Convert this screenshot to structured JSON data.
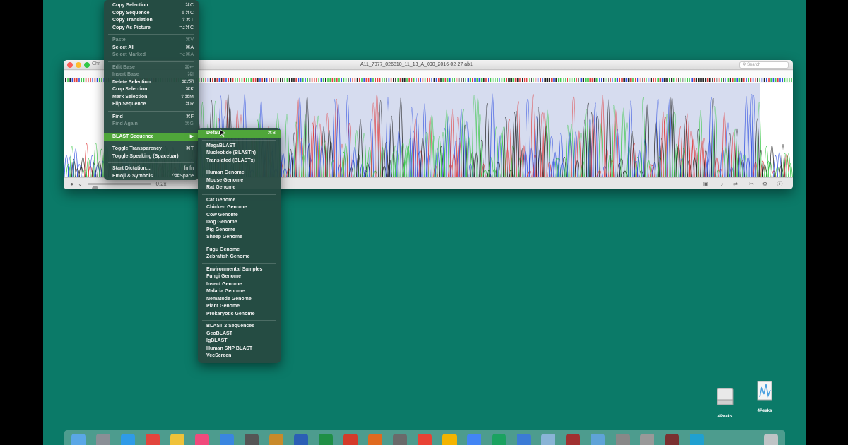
{
  "window": {
    "app_stub": "Chr",
    "title": "A11_7077_026810_11_13_A_090_2016-02-27.ab1",
    "search_placeholder": "Search",
    "zoom_label": "0.2x"
  },
  "ruler": {
    "sequence_hint": "ACGT"
  },
  "main_menu": {
    "items": [
      {
        "label": "Copy Selection",
        "shortcut": "⌘C",
        "disabled": false
      },
      {
        "label": "Copy Sequence",
        "shortcut": "⇧⌘C",
        "disabled": false
      },
      {
        "label": "Copy Translation",
        "shortcut": "⇧⌘T",
        "disabled": false
      },
      {
        "label": "Copy As Picture",
        "shortcut": "⌥⌘C",
        "disabled": false
      },
      {
        "label": "Paste",
        "shortcut": "⌘V",
        "disabled": true
      },
      {
        "label": "Select All",
        "shortcut": "⌘A",
        "disabled": false
      },
      {
        "label": "Select Marked",
        "shortcut": "⌥⌘A",
        "disabled": true
      },
      {
        "label": "Edit Base",
        "shortcut": "⌘↩",
        "disabled": true
      },
      {
        "label": "Insert Base",
        "shortcut": "⌘I",
        "disabled": true
      },
      {
        "label": "Delete Selection",
        "shortcut": "⌘⌫",
        "disabled": false
      },
      {
        "label": "Crop Selection",
        "shortcut": "⌘K",
        "disabled": false
      },
      {
        "label": "Mark Selection",
        "shortcut": "⇧⌘M",
        "disabled": false
      },
      {
        "label": "Flip Sequence",
        "shortcut": "⌘R",
        "disabled": false
      },
      {
        "label": "Find",
        "shortcut": "⌘F",
        "disabled": false
      },
      {
        "label": "Find Again",
        "shortcut": "⌘G",
        "disabled": true
      },
      {
        "label": "BLAST Sequence",
        "shortcut": "▶",
        "disabled": false
      },
      {
        "label": "Toggle Transparency",
        "shortcut": "⌘T",
        "disabled": false
      },
      {
        "label": "Toggle Speaking (Spacebar)",
        "shortcut": "",
        "disabled": false
      },
      {
        "label": "Start Dictation...",
        "shortcut": "fn fn",
        "disabled": false
      },
      {
        "label": "Emoji & Symbols",
        "shortcut": "^⌘Space",
        "disabled": false
      }
    ]
  },
  "blast_menu": {
    "items": [
      {
        "label": "Default",
        "shortcut": "⌘B"
      },
      {
        "label": "MegaBLAST",
        "shortcut": ""
      },
      {
        "label": "Nucleotide (BLASTn)",
        "shortcut": ""
      },
      {
        "label": "Translated (BLASTx)",
        "shortcut": ""
      },
      {
        "label": "Human Genome",
        "shortcut": ""
      },
      {
        "label": "Mouse Genome",
        "shortcut": ""
      },
      {
        "label": "Rat Genome",
        "shortcut": ""
      },
      {
        "label": "Cat Genome",
        "shortcut": ""
      },
      {
        "label": "Chicken Genome",
        "shortcut": ""
      },
      {
        "label": "Cow Genome",
        "shortcut": ""
      },
      {
        "label": "Dog Genome",
        "shortcut": ""
      },
      {
        "label": "Pig Genome",
        "shortcut": ""
      },
      {
        "label": "Sheep Genome",
        "shortcut": ""
      },
      {
        "label": "Fugu Genome",
        "shortcut": ""
      },
      {
        "label": "Zebrafish Genome",
        "shortcut": ""
      },
      {
        "label": "Environmental Samples",
        "shortcut": ""
      },
      {
        "label": "Fungi Genome",
        "shortcut": ""
      },
      {
        "label": "Insect Genome",
        "shortcut": ""
      },
      {
        "label": "Malaria Genome",
        "shortcut": ""
      },
      {
        "label": "Nematode Genome",
        "shortcut": ""
      },
      {
        "label": "Plant Genome",
        "shortcut": ""
      },
      {
        "label": "Prokaryotic Genome",
        "shortcut": ""
      },
      {
        "label": "BLAST 2 Sequences",
        "shortcut": ""
      },
      {
        "label": "GeoBLAST",
        "shortcut": ""
      },
      {
        "label": "IgBLAST",
        "shortcut": ""
      },
      {
        "label": "Human SNP BLAST",
        "shortcut": ""
      },
      {
        "label": "VecScreen",
        "shortcut": ""
      }
    ]
  },
  "desktop_icons": [
    {
      "label": "4Peaks"
    },
    {
      "label": "4Peaks"
    }
  ],
  "colors": {
    "desktop": "#0b7a68",
    "menu_bg": "#264a42",
    "menu_highlight": "#4fa63a",
    "trace_A": "#3cc84a",
    "trace_C": "#3050e0",
    "trace_G": "#222222",
    "trace_T": "#e04040"
  }
}
